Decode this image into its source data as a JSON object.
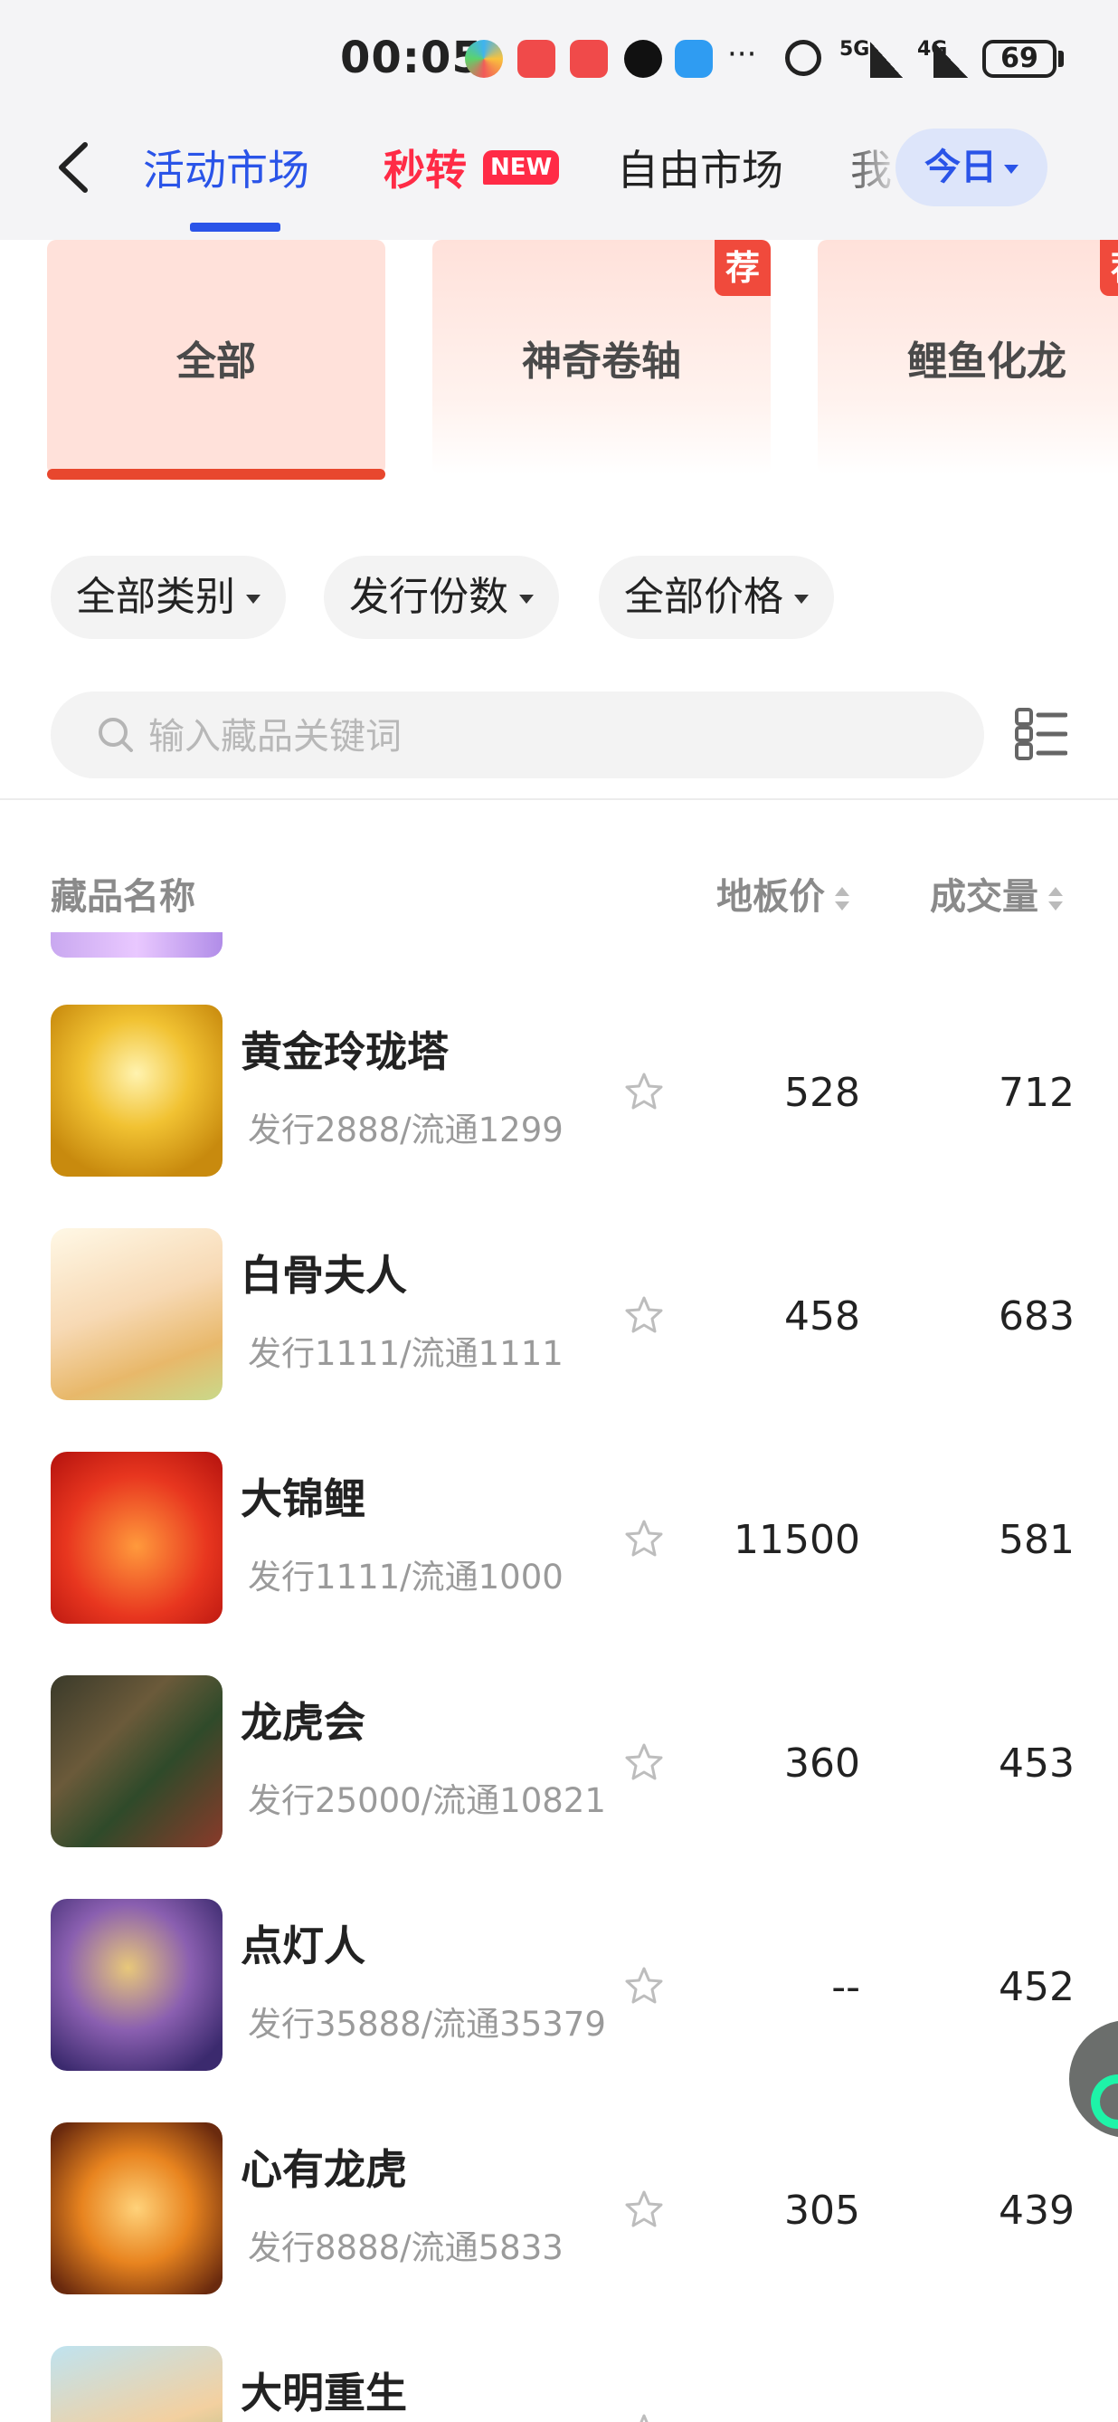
{
  "status_bar": {
    "time": "00:05",
    "network_1": "5G",
    "network_2": "4G",
    "battery": "69"
  },
  "nav": {
    "tabs": [
      {
        "label": "活动市场"
      },
      {
        "label": "秒转",
        "badge": "NEW"
      },
      {
        "label": "自由市场"
      },
      {
        "label": "我"
      }
    ],
    "today_label": "今日"
  },
  "categories": [
    {
      "label": "全部",
      "tag": ""
    },
    {
      "label": "神奇卷轴",
      "tag": "荐"
    },
    {
      "label": "鲤鱼化龙",
      "tag": "荐"
    }
  ],
  "filters": [
    "全部类别",
    "发行份数",
    "全部价格"
  ],
  "search": {
    "placeholder": "输入藏品关键词"
  },
  "table_header": {
    "name": "藏品名称",
    "floor_price": "地板价",
    "volume": "成交量"
  },
  "items": [
    {
      "name": "黄金玲珑塔",
      "sub": "发行2888/流通1299",
      "price": "528",
      "volume": "712"
    },
    {
      "name": "白骨夫人",
      "sub": "发行1111/流通1111",
      "price": "458",
      "volume": "683"
    },
    {
      "name": "大锦鲤",
      "sub": "发行1111/流通1000",
      "price": "11500",
      "volume": "581"
    },
    {
      "name": "龙虎会",
      "sub": "发行25000/流通10821",
      "price": "360",
      "volume": "453"
    },
    {
      "name": "点灯人",
      "sub": "发行35888/流通35379",
      "price": "--",
      "volume": "452"
    },
    {
      "name": "心有龙虎",
      "sub": "发行8888/流通5833",
      "price": "305",
      "volume": "439"
    },
    {
      "name": "大明重生",
      "sub": "",
      "price": "",
      "volume": ""
    }
  ],
  "colors": {
    "accent_blue": "#2a54e8",
    "accent_red": "#ff2b46",
    "category_active": "#e8472e"
  },
  "icons": [
    "back-arrow-icon",
    "search-icon",
    "list-view-icon",
    "star-icon",
    "sort-icon",
    "alarm-icon",
    "more-icon"
  ]
}
